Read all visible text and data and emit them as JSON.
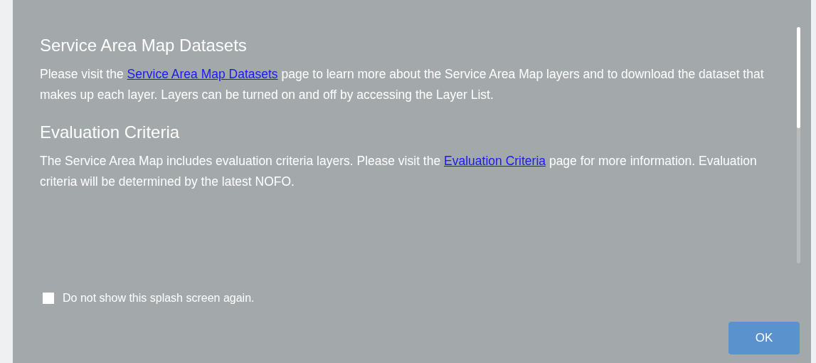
{
  "sections": [
    {
      "heading": "Service Area Map Datasets",
      "text_before": "Please visit the",
      "link": "Service Area Map Datasets",
      "text_after": "page to learn more about the Service Area Map layers and to download the dataset that makes up each layer. Layers can be turned on and off by accessing the Layer List."
    },
    {
      "heading": "Evaluation Criteria",
      "text_before": "The Service Area Map includes evaluation criteria layers. Please visit the",
      "link": "Evaluation Criteria",
      "text_after": "page for more information. Evaluation criteria will be determined by the latest NOFO."
    }
  ],
  "checkbox": {
    "label": "Do not show this splash screen again.",
    "checked": false
  },
  "button": "OK"
}
